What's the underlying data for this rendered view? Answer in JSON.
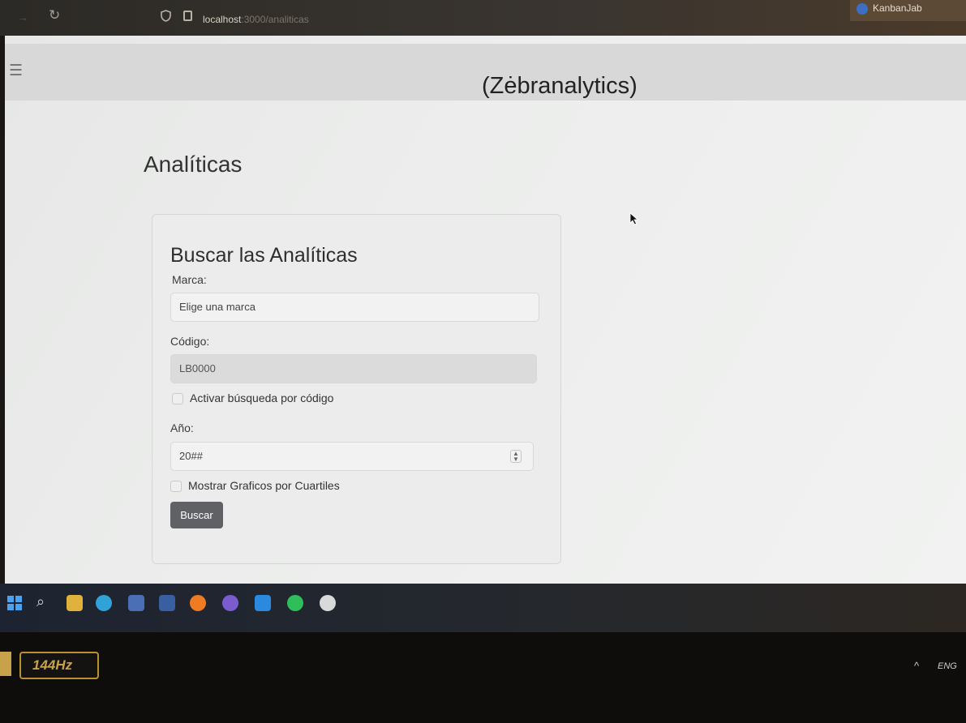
{
  "browser": {
    "url_host": "localhost",
    "url_path": ":3000/analiticas",
    "tab_title": "KanbanJab"
  },
  "header": {
    "menu_icon": "hamburger-icon",
    "brand": "(Zėbranalytics)"
  },
  "page": {
    "title": "Analíticas"
  },
  "form": {
    "title": "Buscar las Analíticas",
    "marca_label": "Marca:",
    "marca_value": "Elige una marca",
    "codigo_label": "Código:",
    "codigo_value": "LB0000",
    "codigo_checkbox_label": "Activar búsqueda por código",
    "anio_label": "Año:",
    "anio_placeholder": "20##",
    "cuartiles_checkbox_label": "Mostrar Graficos por Cuartiles",
    "submit_label": "Buscar"
  },
  "monitor": {
    "refresh_rate": "144Hz"
  },
  "tray": {
    "language": "ENG"
  },
  "icons": {
    "reload": "reload-icon",
    "shield": "shield-icon",
    "page": "page-icon",
    "search": "search-icon",
    "windows": "windows-icon",
    "spinner": "spinner-icon"
  }
}
